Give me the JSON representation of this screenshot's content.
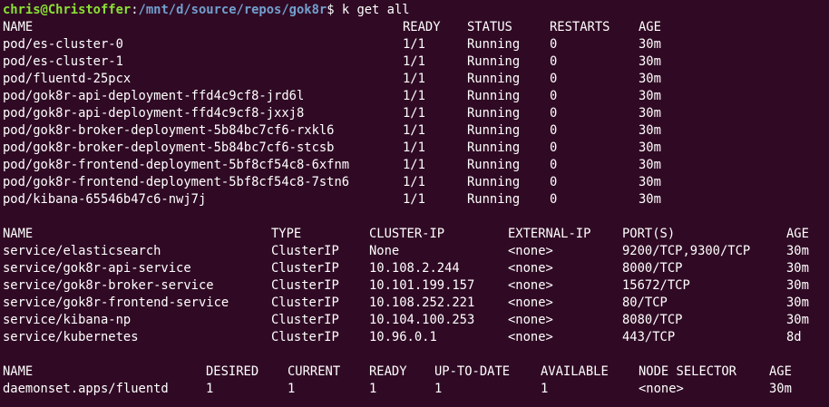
{
  "prompt": {
    "user_host": "chris@Christoffer",
    "separator": ":",
    "path": "/mnt/d/source/repos/gok8r",
    "dollar": "$",
    "command": "k get all"
  },
  "pods": {
    "headers": [
      "NAME",
      "READY",
      "STATUS",
      "RESTARTS",
      "AGE"
    ],
    "rows": [
      [
        "pod/es-cluster-0",
        "1/1",
        "Running",
        "0",
        "30m"
      ],
      [
        "pod/es-cluster-1",
        "1/1",
        "Running",
        "0",
        "30m"
      ],
      [
        "pod/fluentd-25pcx",
        "1/1",
        "Running",
        "0",
        "30m"
      ],
      [
        "pod/gok8r-api-deployment-ffd4c9cf8-jrd6l",
        "1/1",
        "Running",
        "0",
        "30m"
      ],
      [
        "pod/gok8r-api-deployment-ffd4c9cf8-jxxj8",
        "1/1",
        "Running",
        "0",
        "30m"
      ],
      [
        "pod/gok8r-broker-deployment-5b84bc7cf6-rxkl6",
        "1/1",
        "Running",
        "0",
        "30m"
      ],
      [
        "pod/gok8r-broker-deployment-5b84bc7cf6-stcsb",
        "1/1",
        "Running",
        "0",
        "30m"
      ],
      [
        "pod/gok8r-frontend-deployment-5bf8cf54c8-6xfnm",
        "1/1",
        "Running",
        "0",
        "30m"
      ],
      [
        "pod/gok8r-frontend-deployment-5bf8cf54c8-7stn6",
        "1/1",
        "Running",
        "0",
        "30m"
      ],
      [
        "pod/kibana-65546b47c6-nwj7j",
        "1/1",
        "Running",
        "0",
        "30m"
      ]
    ]
  },
  "services": {
    "headers": [
      "NAME",
      "TYPE",
      "CLUSTER-IP",
      "EXTERNAL-IP",
      "PORT(S)",
      "AGE"
    ],
    "rows": [
      [
        "service/elasticsearch",
        "ClusterIP",
        "None",
        "<none>",
        "9200/TCP,9300/TCP",
        "30m"
      ],
      [
        "service/gok8r-api-service",
        "ClusterIP",
        "10.108.2.244",
        "<none>",
        "8000/TCP",
        "30m"
      ],
      [
        "service/gok8r-broker-service",
        "ClusterIP",
        "10.101.199.157",
        "<none>",
        "15672/TCP",
        "30m"
      ],
      [
        "service/gok8r-frontend-service",
        "ClusterIP",
        "10.108.252.221",
        "<none>",
        "80/TCP",
        "30m"
      ],
      [
        "service/kibana-np",
        "ClusterIP",
        "10.104.100.253",
        "<none>",
        "8080/TCP",
        "30m"
      ],
      [
        "service/kubernetes",
        "ClusterIP",
        "10.96.0.1",
        "<none>",
        "443/TCP",
        "8d"
      ]
    ]
  },
  "daemonsets": {
    "headers": [
      "NAME",
      "DESIRED",
      "CURRENT",
      "READY",
      "UP-TO-DATE",
      "AVAILABLE",
      "NODE SELECTOR",
      "AGE"
    ],
    "rows": [
      [
        "daemonset.apps/fluentd",
        "1",
        "1",
        "1",
        "1",
        "1",
        "<none>",
        "30m"
      ]
    ]
  },
  "colors": {
    "background": "#300a24",
    "text": "#ffffff",
    "prompt_user": "#8ae234",
    "prompt_path": "#729fcf"
  }
}
